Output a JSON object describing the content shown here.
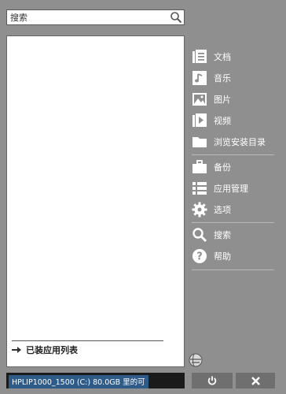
{
  "search": {
    "placeholder": "搜索",
    "icon": "search-icon"
  },
  "installed_list": {
    "label": "已装应用列表",
    "icon": "arrow-right-icon"
  },
  "menu": {
    "items": [
      {
        "label": "文档",
        "icon": "documents-icon"
      },
      {
        "label": "音乐",
        "icon": "music-icon"
      },
      {
        "label": "图片",
        "icon": "pictures-icon"
      },
      {
        "label": "视频",
        "icon": "video-icon"
      },
      {
        "label": "浏览安装目录",
        "icon": "folder-icon"
      },
      {
        "label": "备份",
        "icon": "briefcase-icon"
      },
      {
        "label": "应用管理",
        "icon": "list-icon"
      },
      {
        "label": "选项",
        "icon": "gear-icon"
      },
      {
        "label": "搜索",
        "icon": "search-icon"
      },
      {
        "label": "帮助",
        "icon": "help-icon"
      }
    ]
  },
  "status": {
    "text": "HPLIP1000_1500 (C:) 80.0GB 里的可"
  },
  "buttons": {
    "power": "power-icon",
    "close": "close-icon",
    "update": "globe-update-icon"
  },
  "colors": {
    "background": "#8f8f8f",
    "status_bg": "#1a1a1a",
    "status_highlight": "#2f5b88"
  }
}
